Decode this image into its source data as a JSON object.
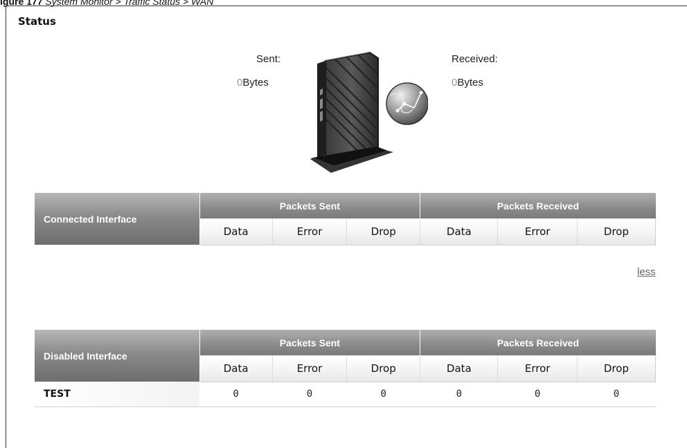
{
  "caption": {
    "prefix": "igure 177",
    "text": "System Monitor > Traffic Status > WAN"
  },
  "status": {
    "title": "Status",
    "sent_label": "Sent:",
    "sent_value": "0",
    "sent_unit": "Bytes",
    "received_label": "Received:",
    "received_value": "0",
    "received_unit": "Bytes"
  },
  "connected_table": {
    "interface_header": "Connected Interface",
    "group_sent": "Packets Sent",
    "group_received": "Packets Received",
    "cols": [
      "Data",
      "Error",
      "Drop",
      "Data",
      "Error",
      "Drop"
    ]
  },
  "less_link": "less",
  "disabled_table": {
    "interface_header": "Disabled Interface",
    "group_sent": "Packets Sent",
    "group_received": "Packets Received",
    "cols": [
      "Data",
      "Error",
      "Drop",
      "Data",
      "Error",
      "Drop"
    ],
    "rows": [
      {
        "name": "TEST",
        "values": [
          "0",
          "0",
          "0",
          "0",
          "0",
          "0"
        ]
      }
    ]
  }
}
